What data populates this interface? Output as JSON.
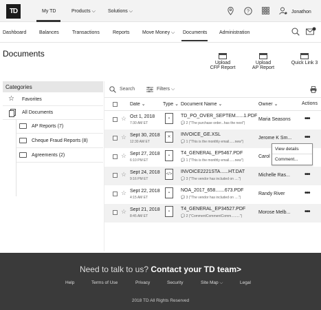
{
  "top_nav": {
    "logo": "TD",
    "items": [
      "My TD",
      "Products",
      "Solutions"
    ],
    "user_name": "Jonathon",
    "icons": [
      "location-icon",
      "help-icon",
      "apps-grid-icon",
      "user-icon"
    ]
  },
  "sub_nav": {
    "items": [
      "Dashboard",
      "Balances",
      "Transactions",
      "Reports",
      "Move Money",
      "Documents",
      "Administration"
    ]
  },
  "page": {
    "title": "Documents",
    "quick_actions": [
      "Upload CFP Report",
      "Upload AP Report",
      "Quick Link 3"
    ],
    "quick_lines": [
      [
        "Upload",
        "CFP Report"
      ],
      [
        "Upload",
        "AP Report"
      ],
      [
        "Quick Link 3",
        ""
      ]
    ]
  },
  "categories": {
    "header": "Categories",
    "favorites": "Favorites",
    "all_documents": "All Documents",
    "folders": [
      {
        "name": "AP Reports",
        "count": "(7)"
      },
      {
        "name": "Cheque Fraud Reports",
        "count": "(8)"
      },
      {
        "name": "Agreements",
        "count": "(2)"
      }
    ]
  },
  "toolbar": {
    "search_label": "Search",
    "filters_label": "Filters"
  },
  "table": {
    "headers": [
      "Date",
      "Type",
      "Document Name",
      "Owner",
      "Actions"
    ],
    "rows": [
      {
        "date": "Oct 1, 2018",
        "time": "7:30 AM ET",
        "type": "pdf",
        "name": "TD_PO_OVER_SEPTEM......1.PDF",
        "comment": "2 (\"The purchase order...has the next\")",
        "owner": "Maria  Seasons"
      },
      {
        "date": "Sept 30, 2018",
        "time": "12:30 AM ET",
        "type": "xsl",
        "name": "INVOICE_GE.XSL",
        "comment": "1 (\"This is the monthly email......new\")",
        "owner": "Jerome K Sm..."
      },
      {
        "date": "Sept 27, 2018",
        "time": "6:10 PM ET",
        "type": "pdf",
        "name": "T4_GENERAL_EP5467.PDF",
        "comment": "1 (\"This is the monthly email......new\")",
        "owner": "Carol"
      },
      {
        "date": "Sept 24, 2018",
        "time": "9:16 PM ET",
        "type": "dat",
        "name": "INVOICE2221STA......HT.DAT",
        "comment": "3 (\"The vendor has included on ....\")",
        "owner": "Michelle Ras..."
      },
      {
        "date": "Sept 22, 2018",
        "time": "4:15 AM ET",
        "type": "pdf",
        "name": "NOA_2017_658.......673.PDF",
        "comment": "3 (\"The vendor has included on ....\")",
        "owner": "Randy  River"
      },
      {
        "date": "Sept 21, 2018",
        "time": "8:45 AM ET",
        "type": "pdf",
        "name": "T4_GENERAL_EP34527.PDF",
        "comment": "2 (\"CommentCommentComm.........\")",
        "owner": "Morose  Melb..."
      }
    ]
  },
  "context_menu": {
    "items": [
      "View details",
      "Comment..."
    ]
  },
  "footer": {
    "cta_light": "Need to talk to us?",
    "cta_bold": "Contact your TD team>",
    "links": [
      "Help",
      "Terms of Use",
      "Privacy",
      "Security",
      "Site Map",
      "Legal"
    ],
    "copyright": "2018 TD  All Rights Reserved"
  }
}
